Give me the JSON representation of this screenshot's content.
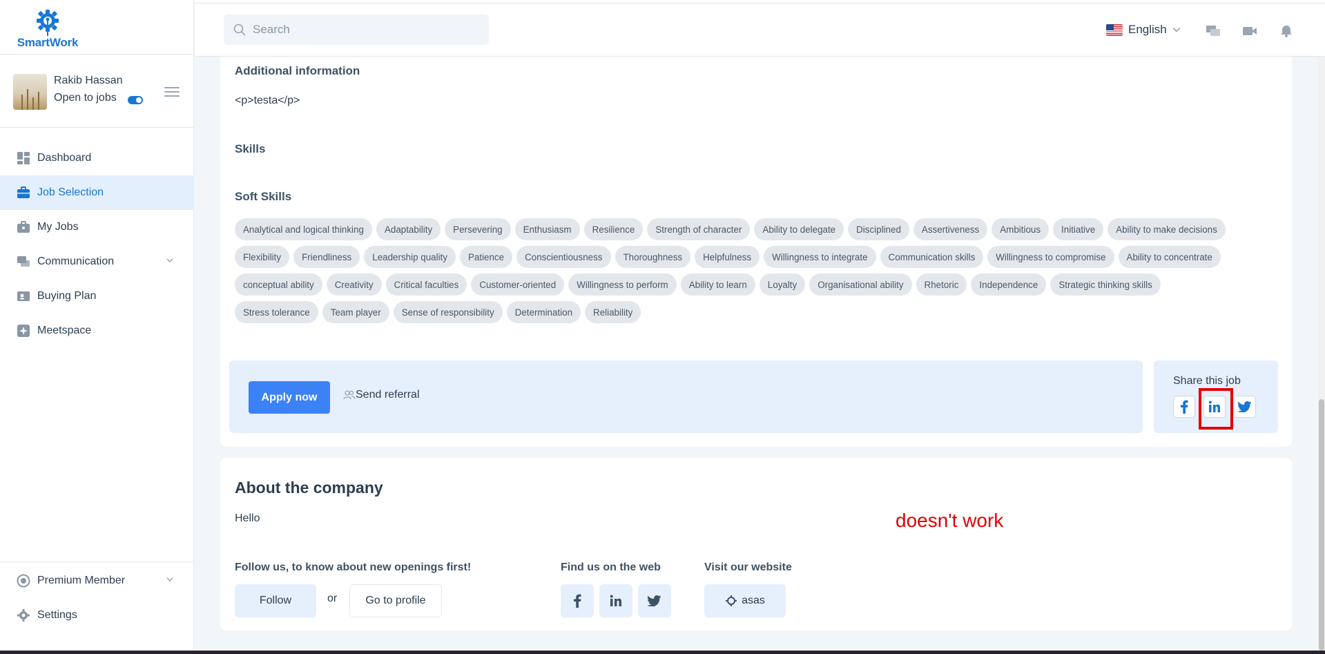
{
  "app": {
    "logo_text": "SmartWork"
  },
  "profile": {
    "name": "Rakib Hassan",
    "status": "Open to jobs"
  },
  "sidebar": {
    "items": [
      {
        "label": "Dashboard",
        "icon": "dashboard-icon"
      },
      {
        "label": "Job Selection",
        "icon": "briefcase-icon",
        "active": true
      },
      {
        "label": "My Jobs",
        "icon": "jobs-bag-icon"
      },
      {
        "label": "Communication",
        "icon": "chat-icon",
        "has_children": true
      },
      {
        "label": "Buying Plan",
        "icon": "buying-plan-icon"
      },
      {
        "label": "Meetspace",
        "icon": "meetspace-icon"
      }
    ],
    "bottom_items": [
      {
        "label": "Premium Member",
        "icon": "premium-icon",
        "has_children": true
      },
      {
        "label": "Settings",
        "icon": "gear-icon"
      }
    ]
  },
  "header": {
    "search_placeholder": "Search",
    "language": "English",
    "icons": [
      "messages-icon",
      "video-icon",
      "bell-icon"
    ]
  },
  "job": {
    "additional_info_title": "Additional information",
    "additional_info_text": "<p>testa</p>",
    "skills_title": "Skills",
    "soft_skills_title": "Soft Skills",
    "soft_skills_rows": [
      [
        "Analytical and logical thinking",
        "Adaptability",
        "Persevering",
        "Enthusiasm",
        "Resilience",
        "Strength of character",
        "Ability to delegate",
        "Disciplined",
        "Assertiveness",
        "Ambitious",
        "Initiative",
        "Ability to make decisions"
      ],
      [
        "Flexibility",
        "Friendliness",
        "Leadership quality",
        "Patience",
        "Conscientiousness",
        "Thoroughness",
        "Helpfulness",
        "Willingness to integrate",
        "Communication skills",
        "Willingness to compromise",
        "Ability to concentrate"
      ],
      [
        "conceptual ability",
        "Creativity",
        "Critical faculties",
        "Customer-oriented",
        "Willingness to perform",
        "Ability to learn",
        "Loyalty",
        "Organisational ability",
        "Rhetoric",
        "Independence",
        "Strategic thinking skills"
      ],
      [
        "Stress tolerance",
        "Team player",
        "Sense of responsibility",
        "Determination",
        "Reliability"
      ]
    ],
    "apply_label": "Apply now",
    "referral_label": "Send referral",
    "share_title": "Share this job"
  },
  "company": {
    "about_title": "About the company",
    "about_text": "Hello",
    "follow_title": "Follow us, to know about new openings first!",
    "follow_label": "Follow",
    "or_label": "or",
    "profile_label": "Go to profile",
    "web_title": "Find us on the web",
    "website_title": "Visit our website",
    "website_label": "asas"
  },
  "annotation": {
    "text": "doesn't work",
    "color": "#e00000"
  },
  "colors": {
    "accent": "#1976d2",
    "apply_button": "#3b82f6",
    "active_nav_bg": "#e3effd"
  }
}
